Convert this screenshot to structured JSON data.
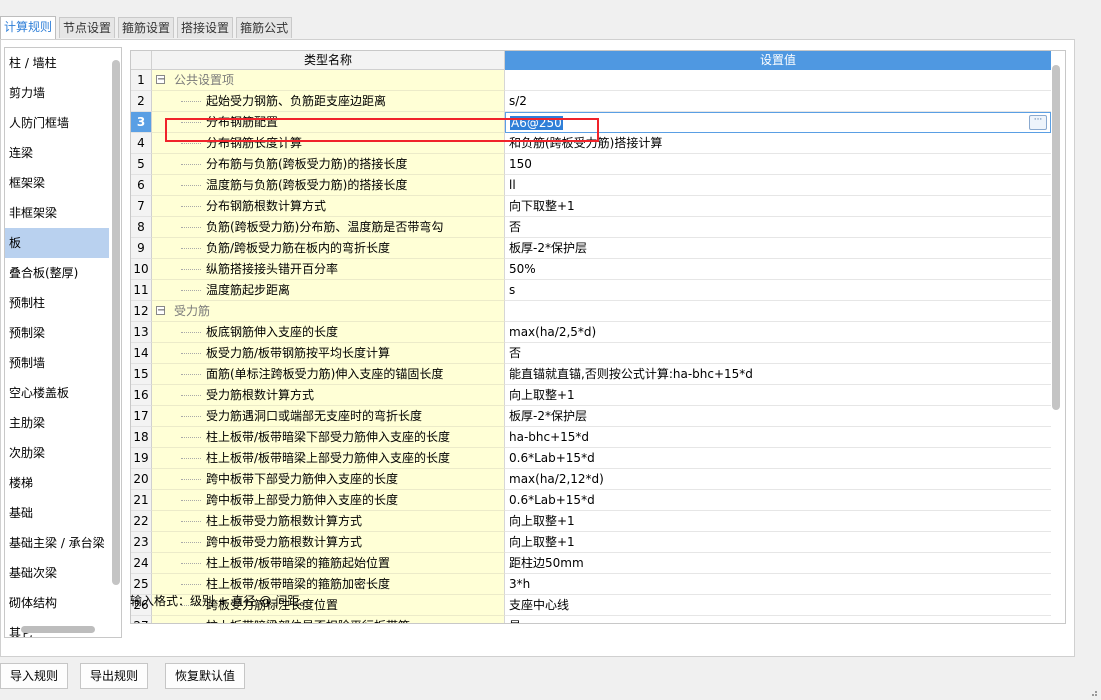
{
  "tabs": [
    {
      "label": "计算规则"
    },
    {
      "label": "节点设置"
    },
    {
      "label": "箍筋设置"
    },
    {
      "label": "搭接设置"
    },
    {
      "label": "箍筋公式"
    }
  ],
  "active_tab": 0,
  "sidebar": {
    "items": [
      "柱 / 墙柱",
      "剪力墙",
      "人防门框墙",
      "连梁",
      "框架梁",
      "非框架梁",
      "板",
      "叠合板(整厚)",
      "预制柱",
      "预制梁",
      "预制墙",
      "空心楼盖板",
      "主肋梁",
      "次肋梁",
      "楼梯",
      "基础",
      "基础主梁 / 承台梁",
      "基础次梁",
      "砌体结构",
      "其它"
    ],
    "selected": 6
  },
  "grid": {
    "header": {
      "name": "类型名称",
      "value": "设置值"
    },
    "rows": [
      {
        "num": "1",
        "group": true,
        "toggle": "−",
        "name": "公共设置项",
        "value": ""
      },
      {
        "num": "2",
        "name": "起始受力钢筋、负筋距支座边距离",
        "value": "s/2"
      },
      {
        "num": "3",
        "name": "分布钢筋配置",
        "value": "A6@250",
        "current": true
      },
      {
        "num": "4",
        "name": "分布钢筋长度计算",
        "value": "和负筋(跨板受力筋)搭接计算"
      },
      {
        "num": "5",
        "name": "分布筋与负筋(跨板受力筋)的搭接长度",
        "value": "150"
      },
      {
        "num": "6",
        "name": "温度筋与负筋(跨板受力筋)的搭接长度",
        "value": "ll"
      },
      {
        "num": "7",
        "name": "分布钢筋根数计算方式",
        "value": "向下取整+1"
      },
      {
        "num": "8",
        "name": "负筋(跨板受力筋)分布筋、温度筋是否带弯勾",
        "value": "否"
      },
      {
        "num": "9",
        "name": "负筋/跨板受力筋在板内的弯折长度",
        "value": "板厚-2*保护层"
      },
      {
        "num": "10",
        "name": "纵筋搭接接头错开百分率",
        "value": "50%"
      },
      {
        "num": "11",
        "name": "温度筋起步距离",
        "value": "s"
      },
      {
        "num": "12",
        "group": true,
        "toggle": "−",
        "name": "受力筋",
        "value": ""
      },
      {
        "num": "13",
        "name": "板底钢筋伸入支座的长度",
        "value": "max(ha/2,5*d)"
      },
      {
        "num": "14",
        "name": "板受力筋/板带钢筋按平均长度计算",
        "value": "否"
      },
      {
        "num": "15",
        "name": "面筋(单标注跨板受力筋)伸入支座的锚固长度",
        "value": "能直锚就直锚,否则按公式计算:ha-bhc+15*d"
      },
      {
        "num": "16",
        "name": "受力筋根数计算方式",
        "value": "向上取整+1"
      },
      {
        "num": "17",
        "name": "受力筋遇洞口或端部无支座时的弯折长度",
        "value": "板厚-2*保护层"
      },
      {
        "num": "18",
        "name": "柱上板带/板带暗梁下部受力筋伸入支座的长度",
        "value": "ha-bhc+15*d"
      },
      {
        "num": "19",
        "name": "柱上板带/板带暗梁上部受力筋伸入支座的长度",
        "value": "0.6*Lab+15*d"
      },
      {
        "num": "20",
        "name": "跨中板带下部受力筋伸入支座的长度",
        "value": "max(ha/2,12*d)"
      },
      {
        "num": "21",
        "name": "跨中板带上部受力筋伸入支座的长度",
        "value": "0.6*Lab+15*d"
      },
      {
        "num": "22",
        "name": "柱上板带受力筋根数计算方式",
        "value": "向上取整+1"
      },
      {
        "num": "23",
        "name": "跨中板带受力筋根数计算方式",
        "value": "向上取整+1"
      },
      {
        "num": "24",
        "name": "柱上板带/板带暗梁的箍筋起始位置",
        "value": "距柱边50mm"
      },
      {
        "num": "25",
        "name": "柱上板带/板带暗梁的箍筋加密长度",
        "value": "3*h"
      },
      {
        "num": "26",
        "name": "跨板受力筋标注长度位置",
        "value": "支座中心线"
      },
      {
        "num": "27",
        "name": "柱上板带暗梁部位是否扣除平行板带筋",
        "value": "是"
      }
    ],
    "ellipsis": "···"
  },
  "hint": "输入格式：级别 + 直径 @ 间距。",
  "buttons": {
    "import": "导入规则",
    "export": "导出规则",
    "restore": "恢复默认值"
  },
  "colors": {
    "accent": "#4f98e1",
    "name_cell_bg": "#ffffd6",
    "highlight": "#f0232a",
    "selection": "#b9d1ef"
  }
}
